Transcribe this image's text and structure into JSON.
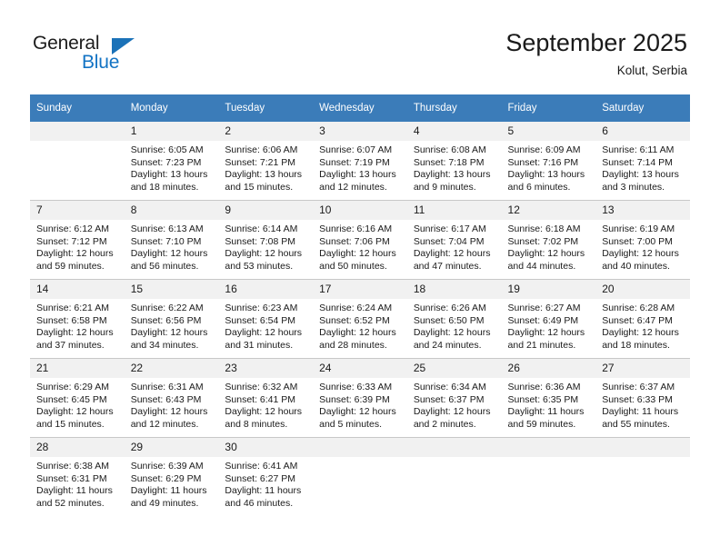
{
  "brand": {
    "name_top": "General",
    "name_bottom": "Blue",
    "accent_color": "#1b72b8",
    "triangle_icon": "triangle-icon"
  },
  "header": {
    "title": "September 2025",
    "subtitle": "Kolut, Serbia"
  },
  "calendar": {
    "header_bg": "#3b7cb9",
    "daynum_bg": "#f1f1f1",
    "grid_line": "#c8c8c8",
    "weekdays": [
      "Sunday",
      "Monday",
      "Tuesday",
      "Wednesday",
      "Thursday",
      "Friday",
      "Saturday"
    ],
    "labels": {
      "sunrise": "Sunrise:",
      "sunset": "Sunset:",
      "daylight": "Daylight:"
    },
    "weeks": [
      [
        {
          "day": "",
          "empty": true
        },
        {
          "day": "1",
          "sunrise": "Sunrise: 6:05 AM",
          "sunset": "Sunset: 7:23 PM",
          "daylight_a": "Daylight: 13 hours",
          "daylight_b": "and 18 minutes."
        },
        {
          "day": "2",
          "sunrise": "Sunrise: 6:06 AM",
          "sunset": "Sunset: 7:21 PM",
          "daylight_a": "Daylight: 13 hours",
          "daylight_b": "and 15 minutes."
        },
        {
          "day": "3",
          "sunrise": "Sunrise: 6:07 AM",
          "sunset": "Sunset: 7:19 PM",
          "daylight_a": "Daylight: 13 hours",
          "daylight_b": "and 12 minutes."
        },
        {
          "day": "4",
          "sunrise": "Sunrise: 6:08 AM",
          "sunset": "Sunset: 7:18 PM",
          "daylight_a": "Daylight: 13 hours",
          "daylight_b": "and 9 minutes."
        },
        {
          "day": "5",
          "sunrise": "Sunrise: 6:09 AM",
          "sunset": "Sunset: 7:16 PM",
          "daylight_a": "Daylight: 13 hours",
          "daylight_b": "and 6 minutes."
        },
        {
          "day": "6",
          "sunrise": "Sunrise: 6:11 AM",
          "sunset": "Sunset: 7:14 PM",
          "daylight_a": "Daylight: 13 hours",
          "daylight_b": "and 3 minutes."
        }
      ],
      [
        {
          "day": "7",
          "sunrise": "Sunrise: 6:12 AM",
          "sunset": "Sunset: 7:12 PM",
          "daylight_a": "Daylight: 12 hours",
          "daylight_b": "and 59 minutes."
        },
        {
          "day": "8",
          "sunrise": "Sunrise: 6:13 AM",
          "sunset": "Sunset: 7:10 PM",
          "daylight_a": "Daylight: 12 hours",
          "daylight_b": "and 56 minutes."
        },
        {
          "day": "9",
          "sunrise": "Sunrise: 6:14 AM",
          "sunset": "Sunset: 7:08 PM",
          "daylight_a": "Daylight: 12 hours",
          "daylight_b": "and 53 minutes."
        },
        {
          "day": "10",
          "sunrise": "Sunrise: 6:16 AM",
          "sunset": "Sunset: 7:06 PM",
          "daylight_a": "Daylight: 12 hours",
          "daylight_b": "and 50 minutes."
        },
        {
          "day": "11",
          "sunrise": "Sunrise: 6:17 AM",
          "sunset": "Sunset: 7:04 PM",
          "daylight_a": "Daylight: 12 hours",
          "daylight_b": "and 47 minutes."
        },
        {
          "day": "12",
          "sunrise": "Sunrise: 6:18 AM",
          "sunset": "Sunset: 7:02 PM",
          "daylight_a": "Daylight: 12 hours",
          "daylight_b": "and 44 minutes."
        },
        {
          "day": "13",
          "sunrise": "Sunrise: 6:19 AM",
          "sunset": "Sunset: 7:00 PM",
          "daylight_a": "Daylight: 12 hours",
          "daylight_b": "and 40 minutes."
        }
      ],
      [
        {
          "day": "14",
          "sunrise": "Sunrise: 6:21 AM",
          "sunset": "Sunset: 6:58 PM",
          "daylight_a": "Daylight: 12 hours",
          "daylight_b": "and 37 minutes."
        },
        {
          "day": "15",
          "sunrise": "Sunrise: 6:22 AM",
          "sunset": "Sunset: 6:56 PM",
          "daylight_a": "Daylight: 12 hours",
          "daylight_b": "and 34 minutes."
        },
        {
          "day": "16",
          "sunrise": "Sunrise: 6:23 AM",
          "sunset": "Sunset: 6:54 PM",
          "daylight_a": "Daylight: 12 hours",
          "daylight_b": "and 31 minutes."
        },
        {
          "day": "17",
          "sunrise": "Sunrise: 6:24 AM",
          "sunset": "Sunset: 6:52 PM",
          "daylight_a": "Daylight: 12 hours",
          "daylight_b": "and 28 minutes."
        },
        {
          "day": "18",
          "sunrise": "Sunrise: 6:26 AM",
          "sunset": "Sunset: 6:50 PM",
          "daylight_a": "Daylight: 12 hours",
          "daylight_b": "and 24 minutes."
        },
        {
          "day": "19",
          "sunrise": "Sunrise: 6:27 AM",
          "sunset": "Sunset: 6:49 PM",
          "daylight_a": "Daylight: 12 hours",
          "daylight_b": "and 21 minutes."
        },
        {
          "day": "20",
          "sunrise": "Sunrise: 6:28 AM",
          "sunset": "Sunset: 6:47 PM",
          "daylight_a": "Daylight: 12 hours",
          "daylight_b": "and 18 minutes."
        }
      ],
      [
        {
          "day": "21",
          "sunrise": "Sunrise: 6:29 AM",
          "sunset": "Sunset: 6:45 PM",
          "daylight_a": "Daylight: 12 hours",
          "daylight_b": "and 15 minutes."
        },
        {
          "day": "22",
          "sunrise": "Sunrise: 6:31 AM",
          "sunset": "Sunset: 6:43 PM",
          "daylight_a": "Daylight: 12 hours",
          "daylight_b": "and 12 minutes."
        },
        {
          "day": "23",
          "sunrise": "Sunrise: 6:32 AM",
          "sunset": "Sunset: 6:41 PM",
          "daylight_a": "Daylight: 12 hours",
          "daylight_b": "and 8 minutes."
        },
        {
          "day": "24",
          "sunrise": "Sunrise: 6:33 AM",
          "sunset": "Sunset: 6:39 PM",
          "daylight_a": "Daylight: 12 hours",
          "daylight_b": "and 5 minutes."
        },
        {
          "day": "25",
          "sunrise": "Sunrise: 6:34 AM",
          "sunset": "Sunset: 6:37 PM",
          "daylight_a": "Daylight: 12 hours",
          "daylight_b": "and 2 minutes."
        },
        {
          "day": "26",
          "sunrise": "Sunrise: 6:36 AM",
          "sunset": "Sunset: 6:35 PM",
          "daylight_a": "Daylight: 11 hours",
          "daylight_b": "and 59 minutes."
        },
        {
          "day": "27",
          "sunrise": "Sunrise: 6:37 AM",
          "sunset": "Sunset: 6:33 PM",
          "daylight_a": "Daylight: 11 hours",
          "daylight_b": "and 55 minutes."
        }
      ],
      [
        {
          "day": "28",
          "sunrise": "Sunrise: 6:38 AM",
          "sunset": "Sunset: 6:31 PM",
          "daylight_a": "Daylight: 11 hours",
          "daylight_b": "and 52 minutes."
        },
        {
          "day": "29",
          "sunrise": "Sunrise: 6:39 AM",
          "sunset": "Sunset: 6:29 PM",
          "daylight_a": "Daylight: 11 hours",
          "daylight_b": "and 49 minutes."
        },
        {
          "day": "30",
          "sunrise": "Sunrise: 6:41 AM",
          "sunset": "Sunset: 6:27 PM",
          "daylight_a": "Daylight: 11 hours",
          "daylight_b": "and 46 minutes."
        },
        {
          "day": "",
          "empty": true
        },
        {
          "day": "",
          "empty": true
        },
        {
          "day": "",
          "empty": true
        },
        {
          "day": "",
          "empty": true
        }
      ]
    ]
  }
}
